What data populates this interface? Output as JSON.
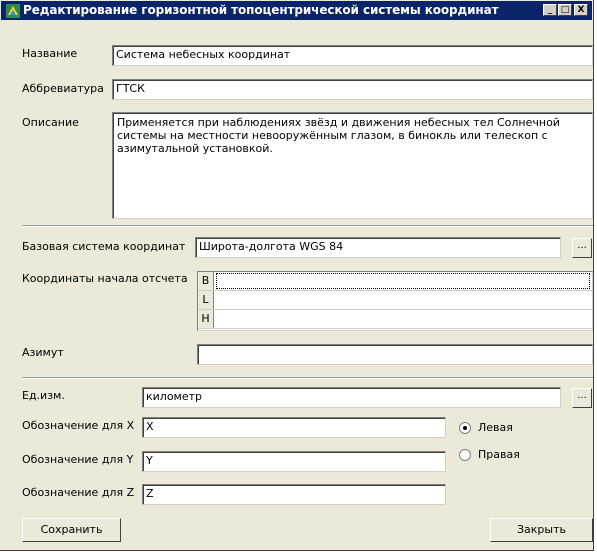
{
  "window": {
    "title": "Редактирование горизонтной топоцентрической системы координат"
  },
  "titlebar_buttons": {
    "minimize": "_",
    "maximize": "□",
    "close": "X"
  },
  "form": {
    "name_label": "Название",
    "name_value": "Система небесных координат",
    "abbr_label": "Аббревиатура",
    "abbr_value": "ГТСК",
    "desc_label": "Описание",
    "desc_value": "Применяется при наблюдениях звёзд и движения небесных тел Солнечной системы на местности невооружённым глазом, в бинокль или телескоп с азимутальной установкой.",
    "base_label": "Базовая система координат",
    "base_value": "Широта-долгота WGS 84",
    "base_browse": "...",
    "origin_label": "Координаты начала отсчета",
    "origin_rows": [
      {
        "key": "B",
        "value": ""
      },
      {
        "key": "L",
        "value": ""
      },
      {
        "key": "H",
        "value": ""
      }
    ],
    "azimuth_label": "Азимут",
    "azimuth_value": "",
    "unit_label": "Ед.изм.",
    "unit_value": "километр",
    "unit_browse": "...",
    "x_label": "Обозначение для X",
    "x_value": "X",
    "y_label": "Обозначение для Y",
    "y_value": "Y",
    "z_label": "Обозначение для Z",
    "z_value": "Z",
    "radio_left": "Левая",
    "radio_right": "Правая",
    "radio_selected": "Левая"
  },
  "buttons": {
    "save": "Сохранить",
    "close": "Закрыть"
  }
}
